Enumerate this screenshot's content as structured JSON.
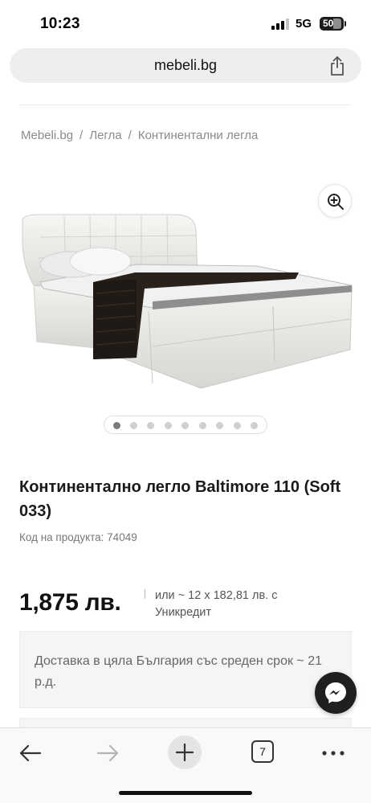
{
  "status_bar": {
    "time": "10:23",
    "network": "5G",
    "battery": "50",
    "icons": [
      "signal-icon",
      "battery-icon"
    ]
  },
  "browser": {
    "url": "mebeli.bg",
    "share_icon": "share-icon"
  },
  "breadcrumb": {
    "items": [
      "Mebeli.bg",
      "Легла",
      "Континентални легла"
    ],
    "separator": "/"
  },
  "gallery": {
    "zoom_icon": "zoom-in-icon",
    "image_count": 9,
    "active_index": 0
  },
  "product": {
    "title": "Континентално легло Baltimore 110 (Soft 033)",
    "code_label": "Код на продукта: 74049",
    "price": "1,875 лв.",
    "installment": "или ~ 12 x 182,81 лв. с Уникредит",
    "delivery": "Доставка в цяла България със среден срок ~ 21 р.д."
  },
  "chat": {
    "icon": "messenger-icon"
  },
  "toolbar": {
    "tab_count": "7",
    "icons": [
      "back-arrow-icon",
      "forward-arrow-icon",
      "plus-icon",
      "tabs-icon",
      "more-icon"
    ]
  },
  "colors": {
    "background": "#ffffff",
    "url_bar": "#eeeef0",
    "muted_text": "#8a8a8a",
    "delivery_box": "#f5f5f5",
    "messenger_button": "#1f1f1f"
  }
}
